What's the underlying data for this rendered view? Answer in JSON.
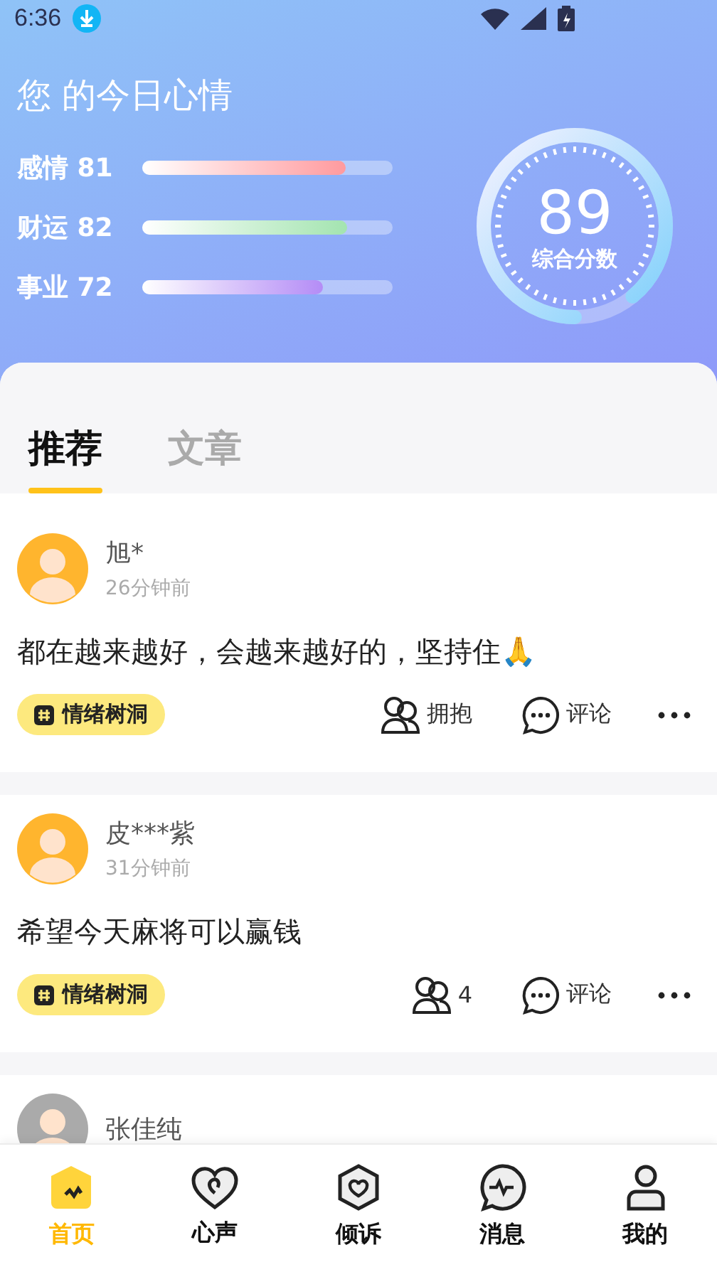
{
  "status_bar": {
    "time": "6:36"
  },
  "mood": {
    "title": "您 的今日心情",
    "score": "89",
    "score_label": "综合分数",
    "level": 0.89,
    "meters": [
      {
        "label": "感情",
        "value": "81",
        "level": 0.81,
        "color": "#ff9a9e"
      },
      {
        "label": "财运",
        "value": "82",
        "level": 0.82,
        "color": "#a3e4b0"
      },
      {
        "label": "事业",
        "value": "72",
        "level": 0.72,
        "color": "#b48cf6"
      }
    ]
  },
  "tabs": [
    {
      "label": "推荐",
      "selected": true
    },
    {
      "label": "文章",
      "selected": false
    }
  ],
  "posts": [
    {
      "name": "旭*",
      "time": "26分钟前",
      "text": "都在越来越好，会越来越好的，坚持住🙏",
      "tag": "情绪树洞",
      "hug": "拥抱",
      "comment": "评论",
      "color": "#ffb52e"
    },
    {
      "name": "皮***紫",
      "time": "31分钟前",
      "text": "希望今天麻将可以赢钱",
      "tag": "情绪树洞",
      "hug": "4",
      "comment": "评论",
      "color": "#ffb52e"
    },
    {
      "name": "张佳纯",
      "color": "#aaaaaa"
    }
  ],
  "nav": [
    {
      "label": "首页",
      "kind": "home",
      "selected": true
    },
    {
      "label": "心声",
      "kind": "heart",
      "selected": false
    },
    {
      "label": "倾诉",
      "kind": "shield",
      "selected": false
    },
    {
      "label": "消息",
      "kind": "message",
      "selected": false
    },
    {
      "label": "我的",
      "kind": "user",
      "selected": false
    }
  ]
}
